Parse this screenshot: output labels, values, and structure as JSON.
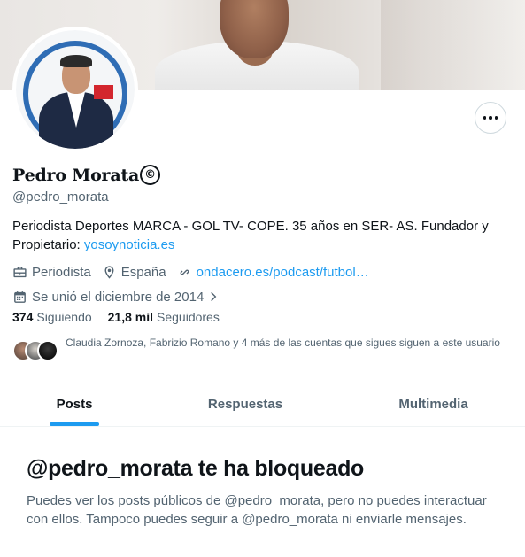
{
  "profile": {
    "name": "Pedro Morata",
    "handle": "@pedro_morata",
    "bio_text": "Periodista Deportes MARCA - GOL TV- COPE. 35 años en SER- AS. Fundador y Propietario: ",
    "bio_link": "yosoynoticia.es",
    "verified_symbol": "©"
  },
  "meta": {
    "job": "Periodista",
    "location": "España",
    "website": "ondacero.es/podcast/futbol…",
    "joined": "Se unió el diciembre de 2014",
    "icons": [
      "briefcase-icon",
      "location-pin-icon",
      "link-icon",
      "calendar-icon"
    ]
  },
  "stats": {
    "following_count": "374",
    "following_label": "Siguiendo",
    "followers_count": "21,8 mil",
    "followers_label": "Seguidores"
  },
  "known_followers": {
    "text": "Claudia Zornoza, Fabrizio Romano y 4 más de las cuentas que sigues siguen a este usuario"
  },
  "tabs": [
    {
      "label": "Posts",
      "active": true
    },
    {
      "label": "Respuestas",
      "active": false
    },
    {
      "label": "Multimedia",
      "active": false
    }
  ],
  "blocked": {
    "title": "@pedro_morata te ha bloqueado",
    "message": "Puedes ver los posts públicos de @pedro_morata, pero no puedes interactuar con ellos. Tampoco puedes seguir a @pedro_morata ni enviarle mensajes."
  },
  "colors": {
    "accent": "#1d9bf0",
    "text_primary": "#0f1419",
    "text_secondary": "#536471"
  }
}
